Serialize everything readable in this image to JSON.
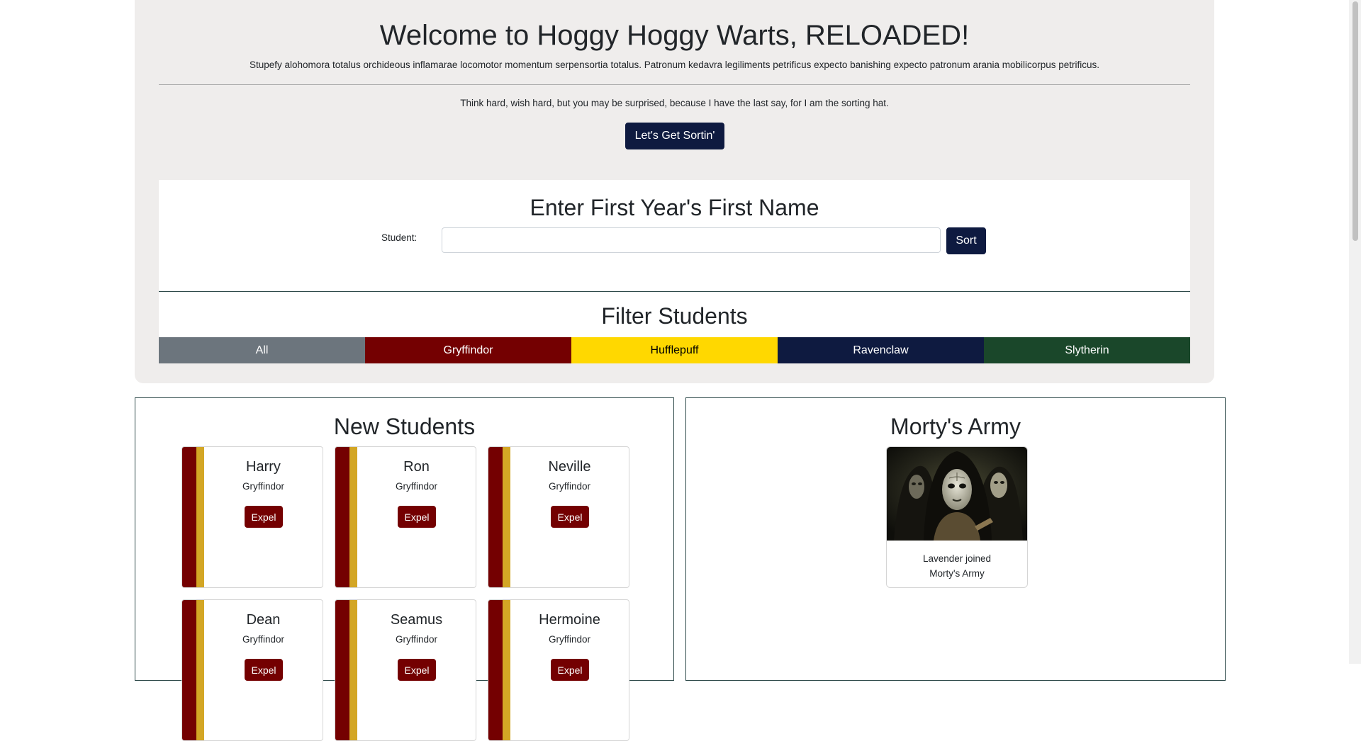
{
  "hero": {
    "title": "Welcome to Hoggy Hoggy Warts, RELOADED!",
    "lead": "Stupefy alohomora totalus orchideous inflamarae locomotor momentum serpensortia totalus. Patronum kedavra legiliments petrificus expecto banishing expecto patronum arania mobilicorpus petrificus.",
    "quote": "Think hard, wish hard, but you may be surprised, because I have the last say, for I am the sorting hat.",
    "button_label": "Let's Get Sortin'"
  },
  "form": {
    "title": "Enter First Year's First Name",
    "student_label": "Student:",
    "student_value": "",
    "sort_label": "Sort"
  },
  "filter": {
    "title": "Filter Students",
    "buttons": [
      {
        "label": "All",
        "color": "#6c757d",
        "text_color": "#ffffff"
      },
      {
        "label": "Gryffindor",
        "color": "#740001",
        "text_color": "#ffffff"
      },
      {
        "label": "Hufflepuff",
        "color": "#ffd800",
        "text_color": "#000000"
      },
      {
        "label": "Ravenclaw",
        "color": "#0e1a40",
        "text_color": "#ffffff"
      },
      {
        "label": "Slytherin",
        "color": "#1a472a",
        "text_color": "#ffffff"
      }
    ]
  },
  "new_students": {
    "title": "New Students",
    "expel_label": "Expel",
    "students": [
      {
        "name": "Harry",
        "house": "Gryffindor"
      },
      {
        "name": "Ron",
        "house": "Gryffindor"
      },
      {
        "name": "Neville",
        "house": "Gryffindor"
      },
      {
        "name": "Dean",
        "house": "Gryffindor"
      },
      {
        "name": "Seamus",
        "house": "Gryffindor"
      },
      {
        "name": "Hermoine",
        "house": "Gryffindor"
      }
    ]
  },
  "army": {
    "title": "Morty's Army",
    "members": [
      {
        "text_line1": "Lavender joined",
        "text_line2": "Morty's Army"
      }
    ]
  },
  "colors": {
    "gryffindor_red": "#740001",
    "gryffindor_gold": "#d3a625",
    "ravenclaw_navy": "#0e1a40"
  }
}
